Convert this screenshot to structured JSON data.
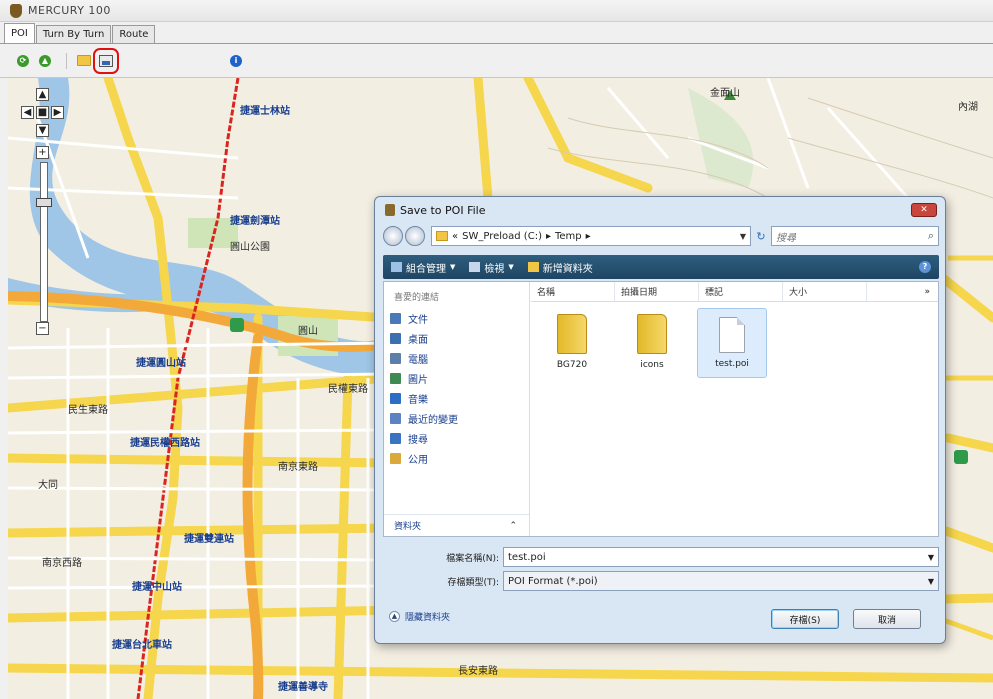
{
  "app": {
    "title": "MERCURY 100"
  },
  "tabs": [
    {
      "label": "POI",
      "active": true
    },
    {
      "label": "Turn By Turn",
      "active": false
    },
    {
      "label": "Route",
      "active": false
    }
  ],
  "toolbar": {
    "icons": [
      "add-green-icon",
      "refresh-green-icon",
      "open-folder-icon",
      "save-poi-icon",
      "info-icon"
    ]
  },
  "map": {
    "labels": [
      {
        "text": "捷運士林站",
        "kind": "poi"
      },
      {
        "text": "捷運劍潭站",
        "kind": "poi"
      },
      {
        "text": "捷運圓山站",
        "kind": "poi"
      },
      {
        "text": "捷運民權西路站",
        "kind": "poi"
      },
      {
        "text": "捷運雙連站",
        "kind": "poi"
      },
      {
        "text": "捷運中山站",
        "kind": "poi"
      },
      {
        "text": "捷運台北車站",
        "kind": "poi"
      },
      {
        "text": "捷運善導寺",
        "kind": "poi"
      },
      {
        "text": "圓山",
        "kind": "road"
      },
      {
        "text": "金面山",
        "kind": "road"
      },
      {
        "text": "內湖",
        "kind": "road"
      },
      {
        "text": "民權東路",
        "kind": "road"
      },
      {
        "text": "南京東路",
        "kind": "road"
      },
      {
        "text": "民生東路",
        "kind": "road"
      },
      {
        "text": "長安東路",
        "kind": "road"
      },
      {
        "text": "南京西路",
        "kind": "road"
      },
      {
        "text": "大同",
        "kind": "road"
      },
      {
        "text": "圓山公園",
        "kind": "road"
      }
    ],
    "zoom": {
      "plus": "+",
      "minus": "−"
    }
  },
  "dialog": {
    "title": "Save to POI File",
    "close_label": "✕",
    "address": {
      "prefix": "«",
      "crumbs": [
        "SW_Preload (C:)",
        "Temp"
      ],
      "separator": "▸"
    },
    "search_placeholder": "搜尋",
    "commands": [
      {
        "label": "組合管理",
        "icon": "organize-icon"
      },
      {
        "label": "檢視",
        "icon": "views-icon"
      },
      {
        "label": "新增資料夾",
        "icon": "new-folder-icon"
      }
    ],
    "nav": {
      "header": "喜愛的連結",
      "items": [
        {
          "label": "文件",
          "color": "#4a78b8"
        },
        {
          "label": "桌面",
          "color": "#3a6fb0"
        },
        {
          "label": "電腦",
          "color": "#5a7fa8"
        },
        {
          "label": "圖片",
          "color": "#3f8a52"
        },
        {
          "label": "音樂",
          "color": "#2b6fc4"
        },
        {
          "label": "最近的變更",
          "color": "#5b83c2"
        },
        {
          "label": "搜尋",
          "color": "#3a74c0"
        },
        {
          "label": "公用",
          "color": "#d9a93a"
        }
      ],
      "folders_label": "資料夾",
      "chevron": "⌃"
    },
    "columns": [
      "名稱",
      "拍攝日期",
      "標記",
      "大小"
    ],
    "columns_more": "»",
    "files": [
      {
        "name": "BG720",
        "type": "folder",
        "selected": false
      },
      {
        "name": "icons",
        "type": "folder",
        "selected": false
      },
      {
        "name": "test.poi",
        "type": "file",
        "selected": true
      }
    ],
    "filename_label": "檔案名稱(N):",
    "filename_value": "test.poi",
    "savetype_label": "存檔類型(T):",
    "savetype_value": "POI Format (*.poi)",
    "hide_folders_label": "隱藏資料夾",
    "save_button": "存檔(S)",
    "cancel_button": "取消"
  }
}
